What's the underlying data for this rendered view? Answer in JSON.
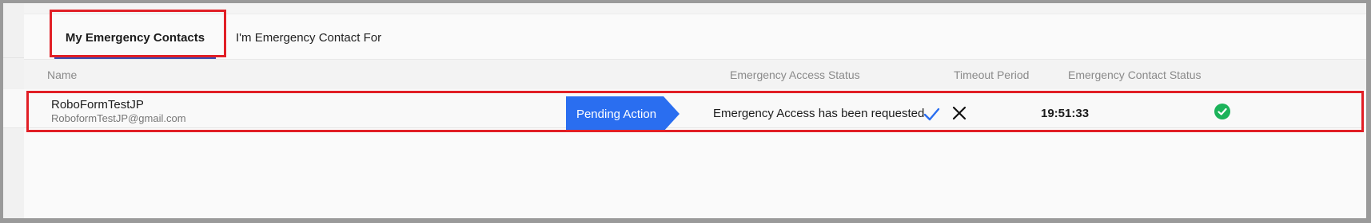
{
  "tabs": {
    "my_contacts": "My Emergency Contacts",
    "contact_for": "I'm Emergency Contact For"
  },
  "table": {
    "headers": {
      "name": "Name",
      "access_status": "Emergency Access Status",
      "timeout": "Timeout Period",
      "contact_status": "Emergency Contact Status"
    },
    "rows": [
      {
        "name": "RoboFormTestJP",
        "email": "RoboformTestJP@gmail.com",
        "pending_label": "Pending Action",
        "access_message": "Emergency Access has been requested",
        "timeout": "19:51:33",
        "contact_status_icon": "check-circle-icon"
      }
    ]
  },
  "colors": {
    "accent_blue": "#2a6ef0",
    "highlight_red": "#e11f26",
    "success_green": "#1cb35a",
    "tab_underline": "#3a4bb0"
  }
}
